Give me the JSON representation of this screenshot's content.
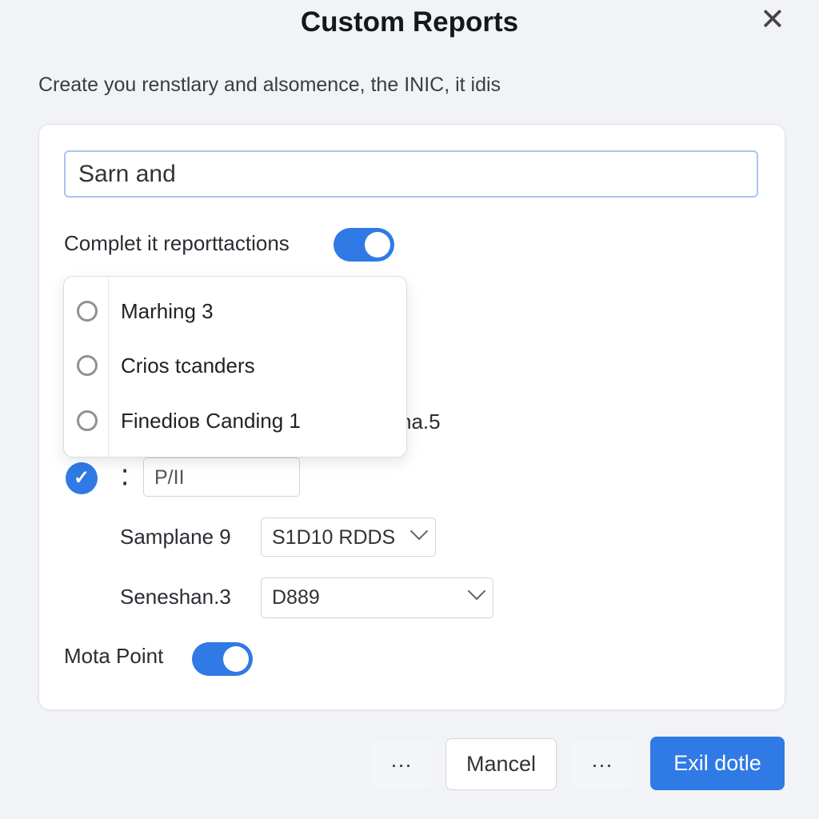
{
  "dialog": {
    "title": "Custom Reports",
    "subtitle": "Create you renstlary and alsomence, the INIC, it idis",
    "close_icon": "close-icon"
  },
  "form": {
    "search_value": "Sarn and",
    "toggle1_label": "Complet it reporttactions",
    "toggle1_on": true,
    "dropdown_options": [
      "Marhing 3",
      "Crios tcanders",
      "Finedioв Canding 1"
    ],
    "hidden_text": "na.5",
    "checked": true,
    "small_glyph": "⁚",
    "small_input_value": "P/II",
    "select1_label": "Samplane 9",
    "select1_value": "S1D10 RDDS",
    "select2_label": "Seneshan.3",
    "select2_value": "D889",
    "toggle2_label": "Mota Point",
    "toggle2_on": true
  },
  "footer": {
    "more1": "···",
    "cancel": "Mancel",
    "more2": "···",
    "primary": "Exil dotle"
  },
  "colors": {
    "accent": "#2f7ae5",
    "background": "#f1f3f6"
  }
}
